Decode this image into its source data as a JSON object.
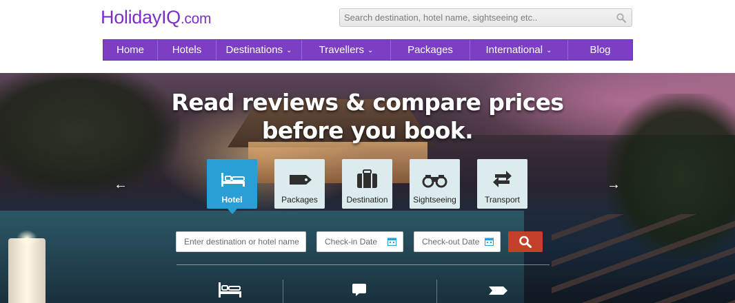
{
  "logo": {
    "main": "HolidayIQ",
    "domain": ".com"
  },
  "search": {
    "placeholder": "Search destination, hotel name, sightseeing etc.."
  },
  "nav": [
    {
      "label": "Home",
      "dropdown": false
    },
    {
      "label": "Hotels",
      "dropdown": false
    },
    {
      "label": "Destinations",
      "dropdown": true
    },
    {
      "label": "Travellers",
      "dropdown": true
    },
    {
      "label": "Packages",
      "dropdown": false
    },
    {
      "label": "International",
      "dropdown": true
    },
    {
      "label": "Blog",
      "dropdown": false
    }
  ],
  "hero": {
    "headline_line1": "Read reviews & compare prices",
    "headline_line2": "before you book.",
    "tabs": [
      {
        "label": "Hotel",
        "icon": "bed-icon",
        "active": true
      },
      {
        "label": "Packages",
        "icon": "tag-icon",
        "active": false
      },
      {
        "label": "Destination",
        "icon": "suitcase-icon",
        "active": false
      },
      {
        "label": "Sightseeing",
        "icon": "binoculars-icon",
        "active": false
      },
      {
        "label": "Transport",
        "icon": "transfer-arrows-icon",
        "active": false
      }
    ],
    "form": {
      "destination_placeholder": "Enter destination or hotel name",
      "checkin_placeholder": "Check-in Date",
      "checkout_placeholder": "Check-out Date"
    }
  },
  "colors": {
    "brand_purple": "#7b3ec4",
    "active_tab": "#2a9fd6",
    "search_button": "#c3402b"
  }
}
